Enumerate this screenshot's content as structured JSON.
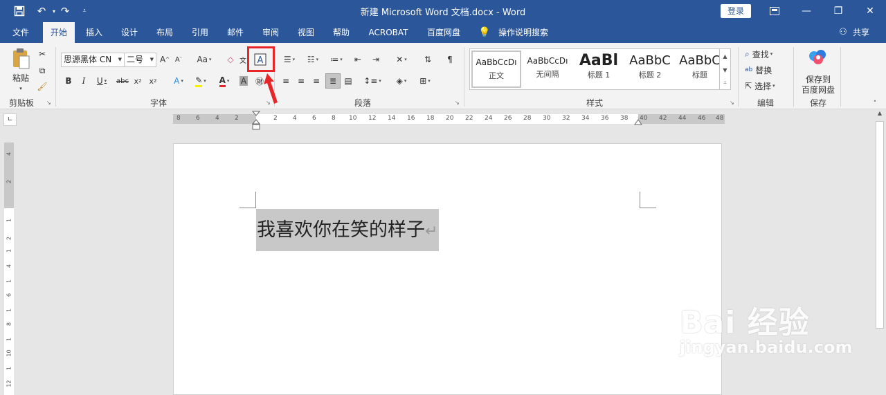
{
  "window": {
    "title": "新建 Microsoft Word 文档.docx  -  Word",
    "login": "登录"
  },
  "tabs": [
    "文件",
    "开始",
    "插入",
    "设计",
    "布局",
    "引用",
    "邮件",
    "审阅",
    "视图",
    "帮助",
    "ACROBAT",
    "百度网盘"
  ],
  "active_tab": "开始",
  "tell_me": "操作说明搜索",
  "share": "共享",
  "clipboard": {
    "paste": "粘贴",
    "label": "剪贴板"
  },
  "font": {
    "name": "思源黑体 CN",
    "size": "二号",
    "aa": "Aa",
    "label": "字体"
  },
  "paragraph": {
    "label": "段落"
  },
  "styles": {
    "label": "样式",
    "items": [
      {
        "sample": "AaBbCcDı",
        "name": "正文"
      },
      {
        "sample": "AaBbCcDı",
        "name": "无间隔"
      },
      {
        "sample": "AaBl",
        "name": "标题 1"
      },
      {
        "sample": "AaBbC",
        "name": "标题 2"
      },
      {
        "sample": "AaBbC",
        "name": "标题"
      }
    ]
  },
  "editing": {
    "find": "查找",
    "replace": "替换",
    "select": "选择",
    "label": "编辑"
  },
  "save": {
    "line1": "保存到",
    "line2": "百度网盘",
    "label": "保存"
  },
  "ruler": {
    "h_left": [
      "8",
      "6",
      "4",
      "2"
    ],
    "h_right": [
      "2",
      "4",
      "6",
      "8",
      "10",
      "12",
      "14",
      "16",
      "18",
      "20",
      "22",
      "24",
      "26",
      "28",
      "30",
      "32",
      "34",
      "36",
      "38",
      "40",
      "42",
      "44",
      "46",
      "48"
    ],
    "v": [
      "4",
      "2",
      "1",
      "2",
      "1",
      "4",
      "1",
      "6",
      "1",
      "8",
      "1",
      "10",
      "1",
      "12"
    ]
  },
  "document": {
    "text": "我喜欢你在笑的样子",
    "para_mark": "↵"
  },
  "watermark": {
    "main": "Bai 经验",
    "sub": "jingyan.baidu.com"
  },
  "colors": {
    "brand": "#2b579a",
    "highlight": "#e8262a",
    "selection": "#c8c8c8"
  }
}
